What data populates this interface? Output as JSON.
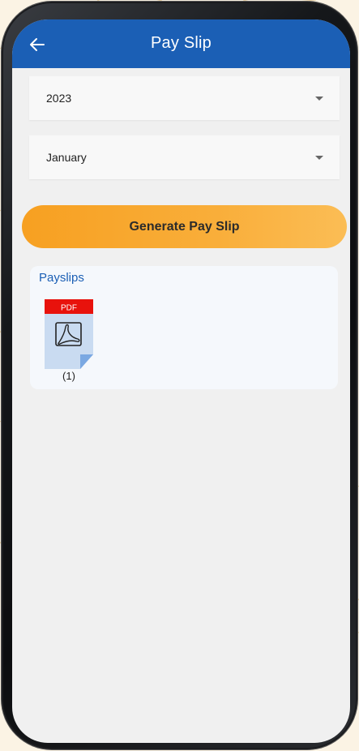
{
  "appbar": {
    "title": "Pay Slip",
    "back_icon": "arrow-left-icon"
  },
  "filters": {
    "year": {
      "value": "2023"
    },
    "month": {
      "value": "January"
    }
  },
  "generate_button": {
    "label": "Generate Pay Slip"
  },
  "payslips": {
    "title": "Payslips",
    "items": [
      {
        "badge": "PDF",
        "label": "(1)"
      }
    ]
  },
  "colors": {
    "appbar": "#1b5fb5",
    "button_start": "#f7a021",
    "button_end": "#fbbd55",
    "pdf_badge": "#e8120c",
    "pdf_body": "#c9dbf1"
  }
}
